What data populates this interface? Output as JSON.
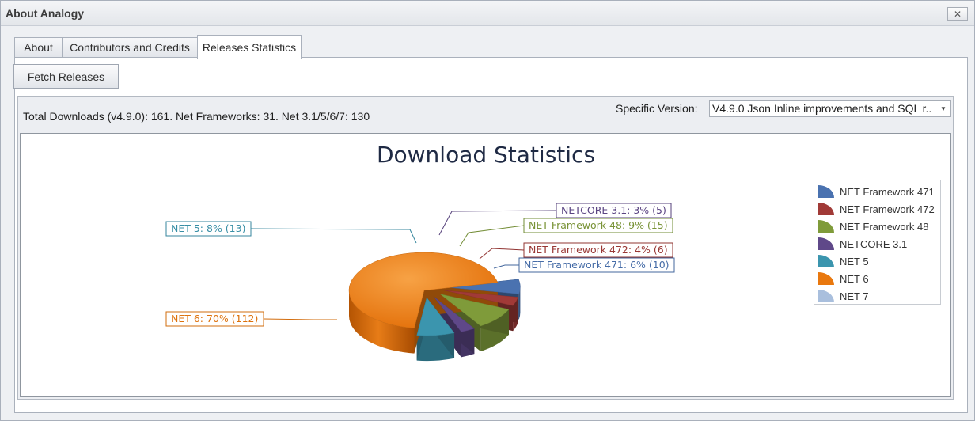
{
  "window": {
    "title": "About Analogy",
    "close_glyph": "✕"
  },
  "tabs": [
    {
      "label": "About"
    },
    {
      "label": "Contributors and Credits"
    },
    {
      "label": "Releases Statistics"
    }
  ],
  "toolbar": {
    "fetch_label": "Fetch Releases"
  },
  "summary": {
    "text": "Total Downloads (v4.9.0): 161. Net Frameworks: 31. Net 3.1/5/6/7: 130"
  },
  "version": {
    "label": "Specific Version:",
    "selected": "V4.9.0 Json Inline improvements and SQL r..."
  },
  "chart_data": {
    "type": "pie",
    "title": "Download Statistics",
    "legend_position": "right",
    "slices": [
      {
        "name": "NET Framework 471",
        "value": 10,
        "percent": 6,
        "label": "NET Framework 471: 6% (10)",
        "color": "#4a72b0"
      },
      {
        "name": "NET Framework 472",
        "value": 6,
        "percent": 4,
        "label": "NET Framework 472: 4% (6)",
        "color": "#a13a37"
      },
      {
        "name": "NET Framework 48",
        "value": 15,
        "percent": 9,
        "label": "NET Framework 48: 9% (15)",
        "color": "#7f9b3a"
      },
      {
        "name": "NETCORE 3.1",
        "value": 5,
        "percent": 3,
        "label": "NETCORE 3.1: 3% (5)",
        "color": "#5f4889"
      },
      {
        "name": "NET 5",
        "value": 13,
        "percent": 8,
        "label": "NET 5: 8% (13)",
        "color": "#3b95ae"
      },
      {
        "name": "NET 6",
        "value": 112,
        "percent": 70,
        "label": "NET 6: 70% (112)",
        "color": "#e9780e"
      },
      {
        "name": "NET 7",
        "value": 0,
        "percent": 0,
        "label": "",
        "color": "#a9bfdd"
      }
    ]
  }
}
